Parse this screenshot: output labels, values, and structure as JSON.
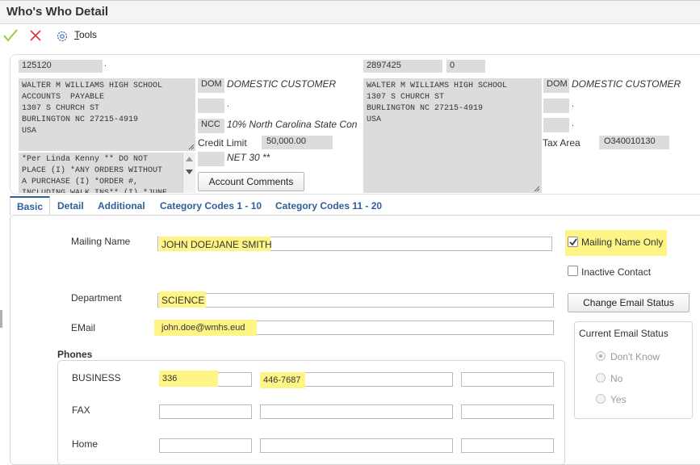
{
  "window": {
    "title": "Who's Who Detail"
  },
  "toolbar": {
    "tools_label_first": "T",
    "tools_label_rest": "ools"
  },
  "header": {
    "left": {
      "account_number": "125120",
      "dot": ".",
      "address_text": "WALTER M WILLIAMS HIGH SCHOOL\nACCOUNTS  PAYABLE\n1307 S CHURCH ST\nBURLINGTON NC 27215-4919\nUSA",
      "notes_text": "*Per Linda Kenny ** DO NOT\nPLACE (I) *ANY ORDERS WITHOUT\nA PURCHASE (I) *ORDER #,\nINCLUDING WALK INS** (I) *JUNE",
      "customer_type_code": "DOM",
      "customer_type_desc": "DOMESTIC CUSTOMER",
      "blank_code_desc": ".",
      "state_code": "NCC",
      "tax_desc": "10% North Carolina State Con",
      "credit_limit_label": "Credit Limit",
      "credit_limit_value": "50,000.00",
      "payment_terms": "NET 30 **",
      "account_comments_button": "Account Comments"
    },
    "right": {
      "address_number": "2897425",
      "line_id": "0",
      "address_text": "WALTER M WILLIAMS HIGH SCHOOL\n1307 S CHURCH ST\nBURLINGTON NC 27215-4919\nUSA",
      "customer_type_code": "DOM",
      "customer_type_desc": "DOMESTIC CUSTOMER",
      "dot_1": ".",
      "dot_2": ".",
      "tax_area_label": "Tax Area",
      "tax_area_value": "O340010130"
    }
  },
  "tabs": [
    "Basic",
    "Detail",
    "Additional",
    "Category Codes 1 - 10",
    "Category Codes 11 - 20"
  ],
  "basic": {
    "mailing_name_label": "Mailing Name",
    "mailing_name_value": "JOHN DOE/JANE SMITH",
    "department_label": "Department",
    "department_value": "SCIENCE",
    "email_label": "EMail",
    "email_value": "john.doe@wmhs.eud",
    "phones_label": "Phones",
    "business_label": "BUSINESS",
    "business_prefix": "336",
    "business_number": "446-7687",
    "fax_label": "FAX",
    "home_label": "Home",
    "mailing_name_only_label": "Mailing Name Only",
    "mailing_name_only_checked": true,
    "inactive_contact_label": "Inactive Contact",
    "inactive_contact_checked": false,
    "change_email_status_button": "Change Email Status",
    "current_email_status_label": "Current Email Status",
    "email_status_options": [
      "Don't Know",
      "No",
      "Yes"
    ],
    "email_status_selected": "Don't Know"
  },
  "colors": {
    "highlight": "#fff586",
    "tab_link": "#2f5f9a",
    "check_green": "#9acd32",
    "cancel_red": "#e03030"
  }
}
